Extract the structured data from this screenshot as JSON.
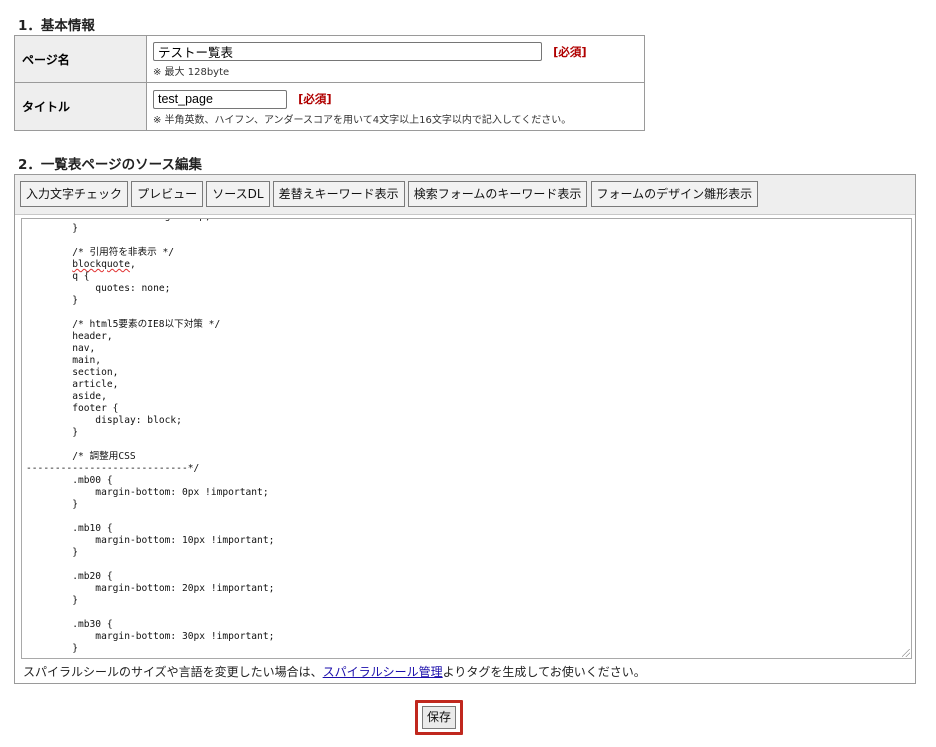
{
  "section1": {
    "title": "1．基本情報"
  },
  "page_name": {
    "label": "ページ名",
    "value": "テストー覧表",
    "required": "[必須]",
    "note": "※ 最大 128byte"
  },
  "title_field": {
    "label": "タイトル",
    "value": "test_page",
    "required": "[必須]",
    "note": "※ 半角英数、ハイフン、アンダースコアを用いて4文字以上16文字以内で記入してください。"
  },
  "section2": {
    "title": "2．一覧表ページのソース編集"
  },
  "toolbar": {
    "buttons": [
      "入力文字チェック",
      "プレビュー",
      "ソースDL",
      "差替えキーワード表示",
      "検索フォームのキーワード表示",
      "フォームのデザイン雛形表示"
    ]
  },
  "code_lines": [
    "            vertical-align: top;",
    "        }",
    "",
    "        /* 引用符を非表示 */",
    "        blockquote,",
    "        q {",
    "            quotes: none;",
    "        }",
    "",
    "        /* html5要素のIE8以下対策 */",
    "        header,",
    "        nav,",
    "        main,",
    "        section,",
    "        article,",
    "        aside,",
    "        footer {",
    "            display: block;",
    "        }",
    "",
    "        /* 調整用CSS",
    "----------------------------*/",
    "        .mb00 {",
    "            margin-bottom: 0px !important;",
    "        }",
    "",
    "        .mb10 {",
    "            margin-bottom: 10px !important;",
    "        }",
    "",
    "        .mb20 {",
    "            margin-bottom: 20px !important;",
    "        }",
    "",
    "        .mb30 {",
    "            margin-bottom: 30px !important;",
    "        }"
  ],
  "footer": {
    "text_before": "スパイラルシールのサイズや言語を変更したい場合は、",
    "link": "スパイラルシール管理",
    "text_after": "よりタグを生成してお使いください。"
  },
  "save_button": "保存"
}
